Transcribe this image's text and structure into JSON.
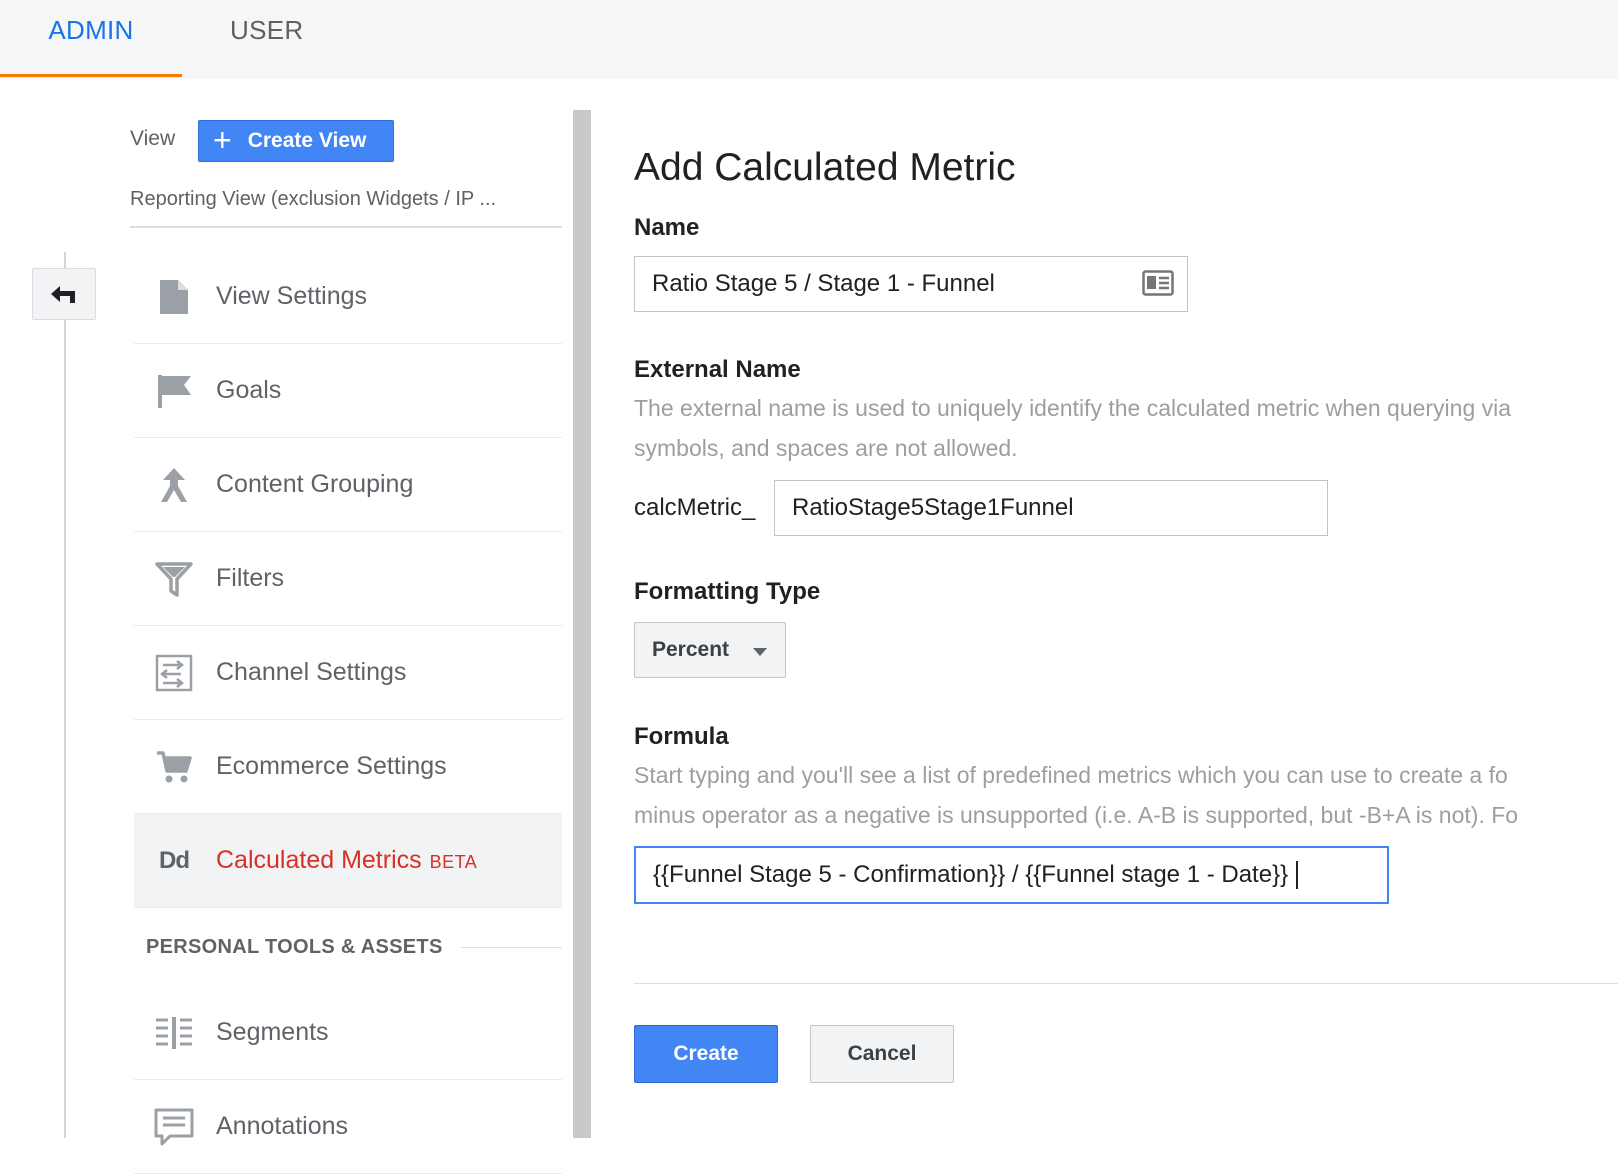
{
  "tabs": [
    {
      "label": "ADMIN",
      "active": true
    },
    {
      "label": "USER",
      "active": false
    }
  ],
  "sidebar": {
    "view_label": "View",
    "create_view_label": "Create View",
    "reporting_view": "Reporting View (exclusion Widgets / IP ...",
    "items": [
      {
        "label": "View Settings",
        "icon": "document-icon"
      },
      {
        "label": "Goals",
        "icon": "flag-icon"
      },
      {
        "label": "Content Grouping",
        "icon": "content-grouping-icon"
      },
      {
        "label": "Filters",
        "icon": "filter-icon"
      },
      {
        "label": "Channel Settings",
        "icon": "channel-settings-icon"
      },
      {
        "label": "Ecommerce Settings",
        "icon": "cart-icon"
      },
      {
        "label": "Calculated Metrics",
        "badge": "BETA",
        "icon": "dd-icon",
        "icon_text": "Dd",
        "active": true
      }
    ],
    "section_heading": "PERSONAL TOOLS & ASSETS",
    "personal_items": [
      {
        "label": "Segments",
        "icon": "segments-icon"
      },
      {
        "label": "Annotations",
        "icon": "annotations-icon"
      }
    ]
  },
  "form": {
    "title": "Add Calculated Metric",
    "name_label": "Name",
    "name_value": "Ratio Stage 5 / Stage 1 - Funnel",
    "external_name_label": "External Name",
    "external_name_help_1": "The external name is used to uniquely identify the calculated metric when querying via",
    "external_name_help_2": "symbols, and spaces are not allowed.",
    "external_prefix": "calcMetric_",
    "external_value": "RatioStage5Stage1Funnel",
    "formatting_type_label": "Formatting Type",
    "formatting_type_value": "Percent",
    "formula_label": "Formula",
    "formula_help_1": "Start typing and you'll see a list of predefined metrics which you can use to create a fo",
    "formula_help_2": "minus operator as a negative is unsupported (i.e. A-B is supported, but -B+A is not). Fo",
    "formula_value": "{{Funnel Stage 5 - Confirmation}} / {{Funnel stage 1 - Date}}",
    "create_label": "Create",
    "cancel_label": "Cancel"
  },
  "colors": {
    "accent_blue": "#4285f4",
    "tab_active": "#1a73e8",
    "tab_underline": "#f57c00",
    "active_item": "#d93025"
  }
}
